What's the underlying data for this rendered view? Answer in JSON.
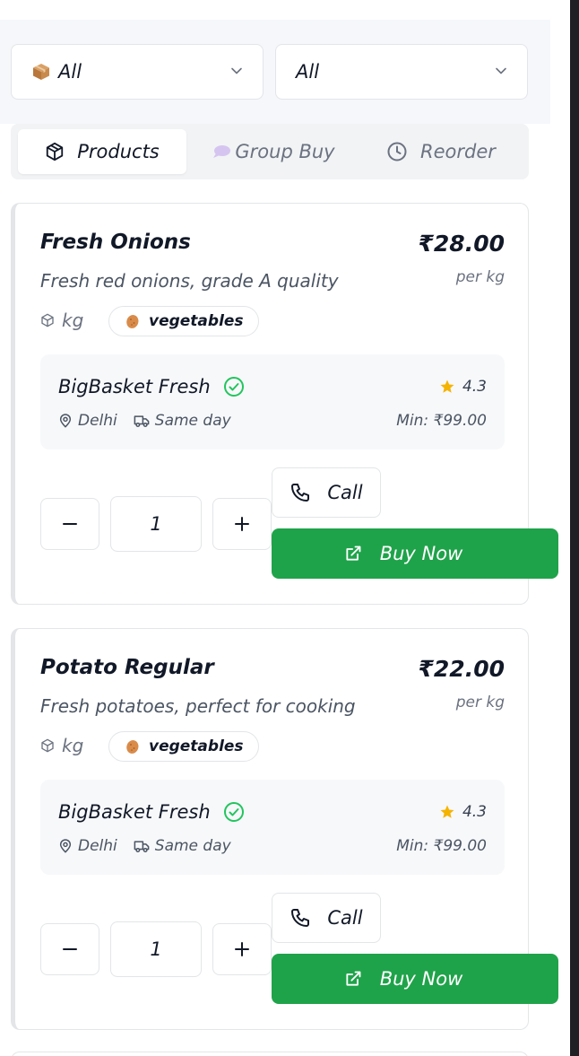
{
  "filters": {
    "category": {
      "value": "All",
      "icon": "package-icon"
    },
    "location": {
      "value": "All"
    }
  },
  "tabs": [
    {
      "label": "Products",
      "icon": "cube-icon",
      "active": true
    },
    {
      "label": "Group Buy",
      "icon": "chat-bubble-icon",
      "active": false
    },
    {
      "label": "Reorder",
      "icon": "clock-icon",
      "active": false
    }
  ],
  "products": [
    {
      "name": "Fresh Onions",
      "price": "₹28.00",
      "per_unit": "per kg",
      "description": "Fresh red onions, grade A quality",
      "unit": "kg",
      "category_tag": "vegetables",
      "vendor": {
        "name": "BigBasket Fresh",
        "verified": true,
        "rating": "4.3",
        "location": "Delhi",
        "delivery": "Same day",
        "min_order": "Min: ₹99.00"
      },
      "quantity": "1",
      "call_label": "Call",
      "buy_label": "Buy Now"
    },
    {
      "name": "Potato Regular",
      "price": "₹22.00",
      "per_unit": "per kg",
      "description": "Fresh potatoes, perfect for cooking",
      "unit": "kg",
      "category_tag": "vegetables",
      "vendor": {
        "name": "BigBasket Fresh",
        "verified": true,
        "rating": "4.3",
        "location": "Delhi",
        "delivery": "Same day",
        "min_order": "Min: ₹99.00"
      },
      "quantity": "1",
      "call_label": "Call",
      "buy_label": "Buy Now"
    }
  ],
  "colors": {
    "accent_green": "#1fa34a",
    "verified_green": "#22c55e",
    "star": "#f5b301",
    "muted": "#6b7280"
  }
}
